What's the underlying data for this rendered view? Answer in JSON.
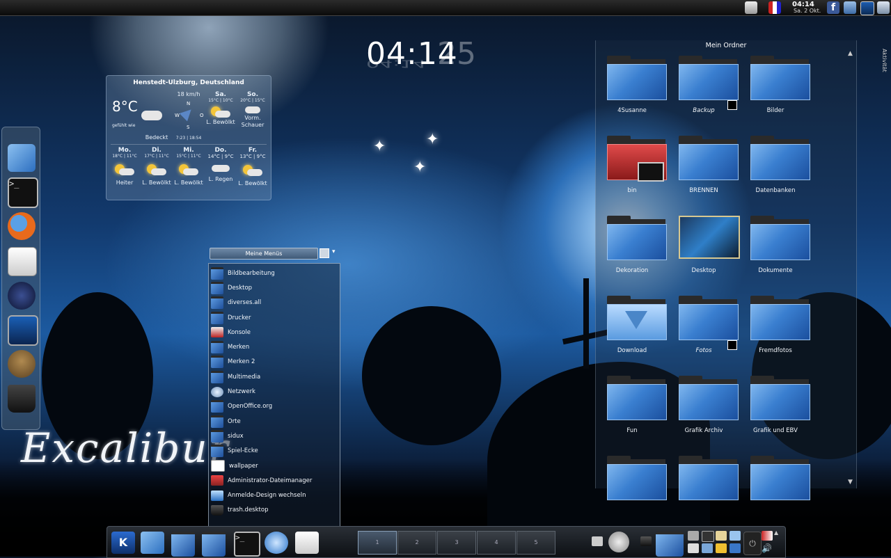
{
  "top_panel": {
    "time": "04:14",
    "date": "Sa. 2 Okt.",
    "tray_icons": [
      "printer-icon",
      "network-meter-icon",
      "facebook-icon",
      "window-icon",
      "monitor-icon",
      "display-icon"
    ]
  },
  "big_clock": {
    "time": "04:14",
    "seconds": "25"
  },
  "weather": {
    "location": "Henstedt-Ulzburg, Deutschland",
    "current_temp": "8°C",
    "wind": "18 km/h",
    "compass": {
      "n": "N",
      "w": "W",
      "o": "O",
      "s": "S"
    },
    "current_condition": "Bedeckt",
    "sun_times": "7:23 | 18:54",
    "feels_small": "gefühlt wie",
    "top_days": [
      {
        "day": "Sa.",
        "temps": "15°C | 10°C",
        "condition": "L. Bewölkt"
      },
      {
        "day": "So.",
        "temps": "20°C | 15°C",
        "condition": "Vorm. Schauer"
      }
    ],
    "days": [
      {
        "day": "Mo.",
        "temps": "18°C | 11°C",
        "condition": "Heiter"
      },
      {
        "day": "Di.",
        "temps": "17°C | 11°C",
        "condition": "L. Bewölkt"
      },
      {
        "day": "Mi.",
        "temps": "15°C | 11°C",
        "condition": "L. Bewölkt"
      },
      {
        "day": "Do.",
        "temps": "14°C | 9°C",
        "condition": "L. Regen"
      },
      {
        "day": "Fr.",
        "temps": "13°C | 9°C",
        "condition": "L. Bewölkt"
      }
    ]
  },
  "left_dock": {
    "icons": [
      "home-folder-icon",
      "terminal-icon",
      "firefox-icon",
      "calendar-icon",
      "wolf-icon",
      "monitor-icon",
      "gimp-icon",
      "trash-icon"
    ]
  },
  "wallpaper_title": "Excalibur",
  "menu": {
    "title": "Meine Menüs",
    "items": [
      {
        "label": "Bildbearbeitung",
        "icon": "folder"
      },
      {
        "label": "Desktop",
        "icon": "folder"
      },
      {
        "label": "diverses.all",
        "icon": "folder"
      },
      {
        "label": "Drucker",
        "icon": "folder"
      },
      {
        "label": "Konsole",
        "icon": "konsole"
      },
      {
        "label": "Merken",
        "icon": "folder"
      },
      {
        "label": "Merken 2",
        "icon": "folder"
      },
      {
        "label": "Multimedia",
        "icon": "folder"
      },
      {
        "label": "Netzwerk",
        "icon": "network"
      },
      {
        "label": "OpenOffice.org",
        "icon": "folder"
      },
      {
        "label": "Orte",
        "icon": "folder"
      },
      {
        "label": "sidux",
        "icon": "folder"
      },
      {
        "label": "Spiel-Ecke",
        "icon": "folder"
      },
      {
        "label": "wallpaper",
        "icon": "file"
      },
      {
        "label": "Administrator-Dateimanager",
        "icon": "admin"
      },
      {
        "label": "Anmelde-Design wechseln",
        "icon": "login"
      },
      {
        "label": "trash.desktop",
        "icon": "trash"
      }
    ]
  },
  "folder_view": {
    "title": "Mein Ordner",
    "side_label": "Aktivität",
    "items": [
      {
        "label": "4Susanne",
        "italic": false,
        "link": false,
        "kind": "folder"
      },
      {
        "label": "Backup",
        "italic": true,
        "link": true,
        "kind": "folder"
      },
      {
        "label": "Bilder",
        "italic": false,
        "link": false,
        "kind": "folder"
      },
      {
        "label": "bin",
        "italic": false,
        "link": false,
        "kind": "red"
      },
      {
        "label": "BRENNEN",
        "italic": false,
        "link": false,
        "kind": "folder"
      },
      {
        "label": "Datenbanken",
        "italic": false,
        "link": false,
        "kind": "folder"
      },
      {
        "label": "Dekoration",
        "italic": false,
        "link": false,
        "kind": "folder"
      },
      {
        "label": "Desktop",
        "italic": false,
        "link": false,
        "kind": "desktop"
      },
      {
        "label": "Dokumente",
        "italic": false,
        "link": false,
        "kind": "folder"
      },
      {
        "label": "Download",
        "italic": false,
        "link": false,
        "kind": "download"
      },
      {
        "label": "Fotos",
        "italic": true,
        "link": true,
        "kind": "folder"
      },
      {
        "label": "Fremdfotos",
        "italic": false,
        "link": false,
        "kind": "folder"
      },
      {
        "label": "Fun",
        "italic": false,
        "link": false,
        "kind": "folder"
      },
      {
        "label": "Grafik Archiv",
        "italic": false,
        "link": false,
        "kind": "folder"
      },
      {
        "label": "Grafik und EBV",
        "italic": false,
        "link": false,
        "kind": "folder"
      },
      {
        "label": "",
        "italic": false,
        "link": false,
        "kind": "folder"
      },
      {
        "label": "",
        "italic": false,
        "link": false,
        "kind": "folder"
      },
      {
        "label": "",
        "italic": false,
        "link": false,
        "kind": "folder"
      }
    ]
  },
  "bottom_panel": {
    "launchers": [
      "kde-menu-icon",
      "home-icon",
      "folder-icon",
      "folder-icon-2",
      "terminal-icon",
      "browser-icon",
      "calendar-icon"
    ],
    "pager": [
      "1",
      "2",
      "3",
      "4",
      "5"
    ],
    "active_desktop": 0,
    "tray": [
      "camera-icon",
      "disk-icon",
      "trash-icon",
      "folder-icon",
      "tools-icon",
      "monitor-icon",
      "notes-icon",
      "drive-icon",
      "lock-icon",
      "network-icon",
      "volume-icon",
      "flag-icon"
    ]
  }
}
